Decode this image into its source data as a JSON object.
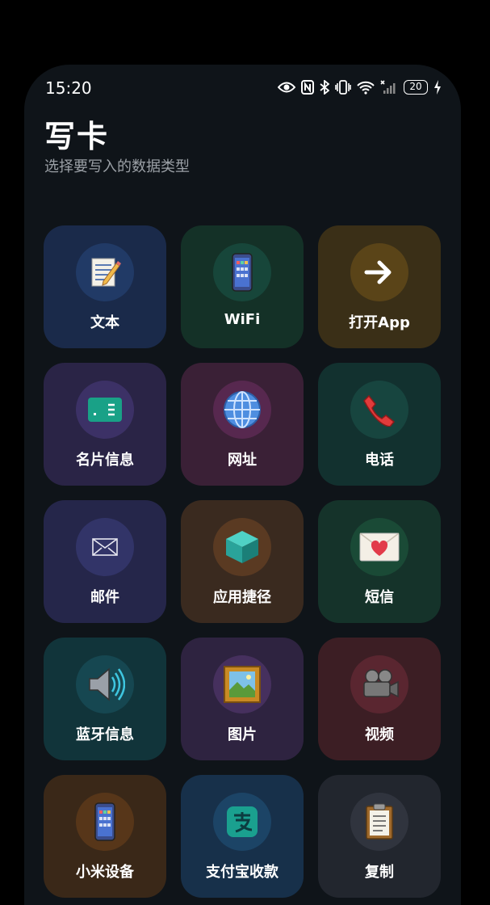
{
  "status_bar": {
    "time": "15:20",
    "battery": "20",
    "icons": [
      "eye-icon",
      "nfc-icon",
      "bluetooth-icon",
      "vibrate-icon",
      "wifi-icon",
      "no-signal-icon",
      "battery-icon",
      "charging-icon"
    ]
  },
  "header": {
    "title": "写卡",
    "subtitle": "选择要写入的数据类型"
  },
  "tiles": [
    {
      "label": "文本",
      "icon": "memo-icon",
      "bg": "#1a2a4a",
      "circle": "#213a66"
    },
    {
      "label": "WiFi",
      "icon": "phone-icon",
      "bg": "#143127",
      "circle": "#17463a"
    },
    {
      "label": "打开App",
      "icon": "arrow-right-icon",
      "bg": "#3a2f17",
      "circle": "#5a4418"
    },
    {
      "label": "名片信息",
      "icon": "id-card-icon",
      "bg": "#2a2446",
      "circle": "#3c3166"
    },
    {
      "label": "网址",
      "icon": "globe-icon",
      "bg": "#3a2036",
      "circle": "#57284f"
    },
    {
      "label": "电话",
      "icon": "telephone-icon",
      "bg": "#12312f",
      "circle": "#17453f"
    },
    {
      "label": "邮件",
      "icon": "envelope-icon",
      "bg": "#25264a",
      "circle": "#323468"
    },
    {
      "label": "应用捷径",
      "icon": "cube-icon",
      "bg": "#3a2a1f",
      "circle": "#5a3a22"
    },
    {
      "label": "短信",
      "icon": "love-letter-icon",
      "bg": "#15332a",
      "circle": "#1a4a36"
    },
    {
      "label": "蓝牙信息",
      "icon": "speaker-icon",
      "bg": "#11343a",
      "circle": "#164751"
    },
    {
      "label": "图片",
      "icon": "framed-picture-icon",
      "bg": "#2e2340",
      "circle": "#46305e"
    },
    {
      "label": "视频",
      "icon": "video-camera-icon",
      "bg": "#3c1e24",
      "circle": "#5a2630"
    },
    {
      "label": "小米设备",
      "icon": "phone-icon",
      "bg": "#3a2818",
      "circle": "#573619"
    },
    {
      "label": "支付宝收款",
      "icon": "alipay-icon",
      "bg": "#17304a",
      "circle": "#1c4466"
    },
    {
      "label": "复制",
      "icon": "clipboard-icon",
      "bg": "#22262e",
      "circle": "#30343e"
    }
  ]
}
